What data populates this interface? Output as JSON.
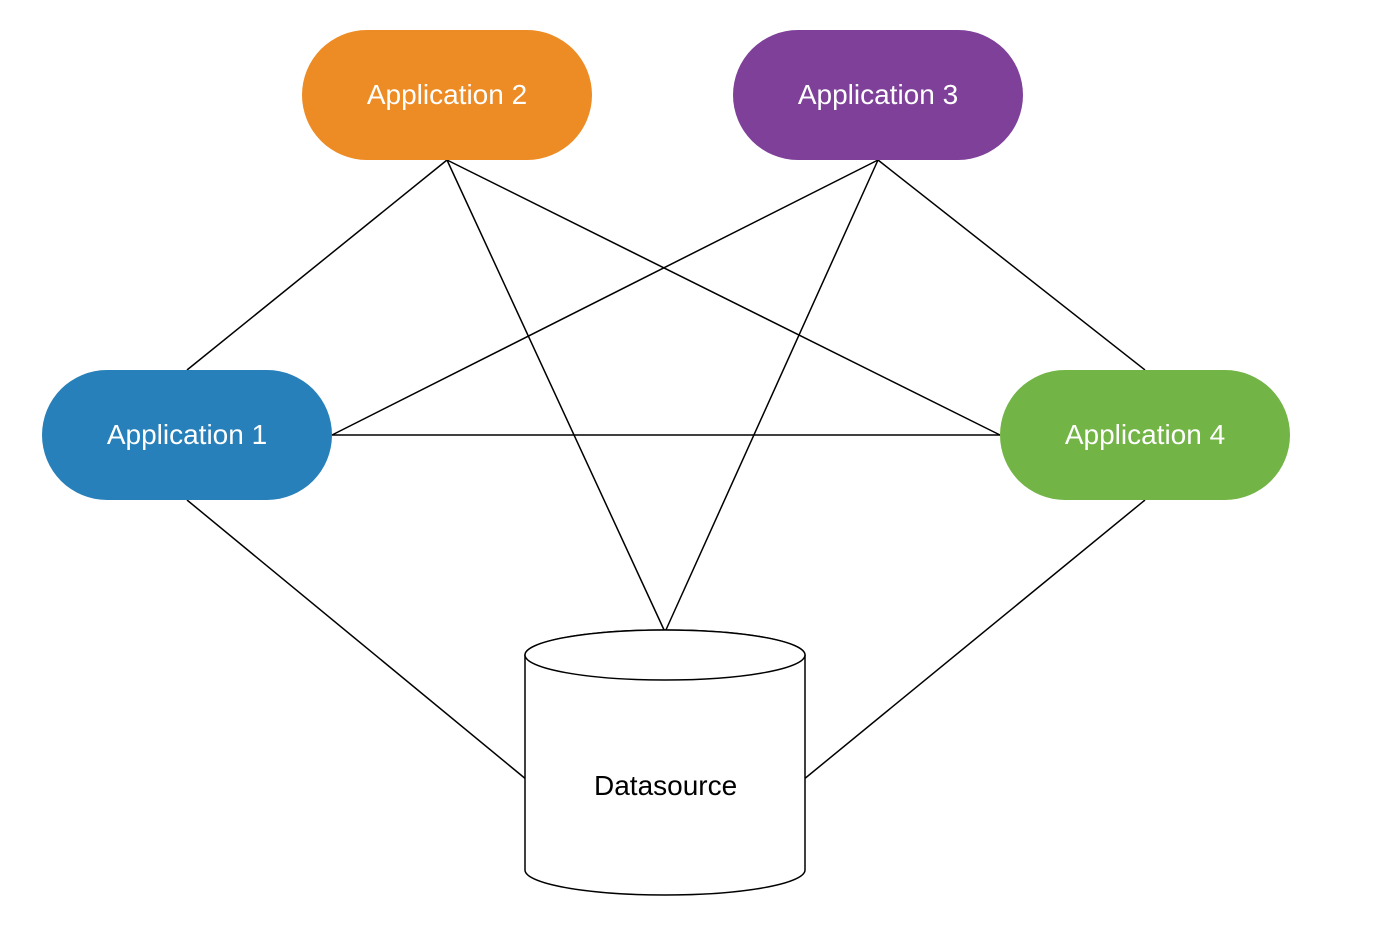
{
  "nodes": {
    "app1": {
      "label": "Application 1",
      "color": "#2780b9"
    },
    "app2": {
      "label": "Application 2",
      "color": "#ed8b24"
    },
    "app3": {
      "label": "Application 3",
      "color": "#7e4098"
    },
    "app4": {
      "label": "Application 4",
      "color": "#72b445"
    },
    "datasource": {
      "label": "Datasource",
      "color": "#ffffff"
    }
  },
  "connections": [
    [
      "app1",
      "app2"
    ],
    [
      "app1",
      "app3"
    ],
    [
      "app1",
      "app4"
    ],
    [
      "app1",
      "datasource"
    ],
    [
      "app2",
      "app3"
    ],
    [
      "app2",
      "app4"
    ],
    [
      "app2",
      "datasource"
    ],
    [
      "app3",
      "app4"
    ],
    [
      "app3",
      "datasource"
    ],
    [
      "app4",
      "datasource"
    ]
  ]
}
